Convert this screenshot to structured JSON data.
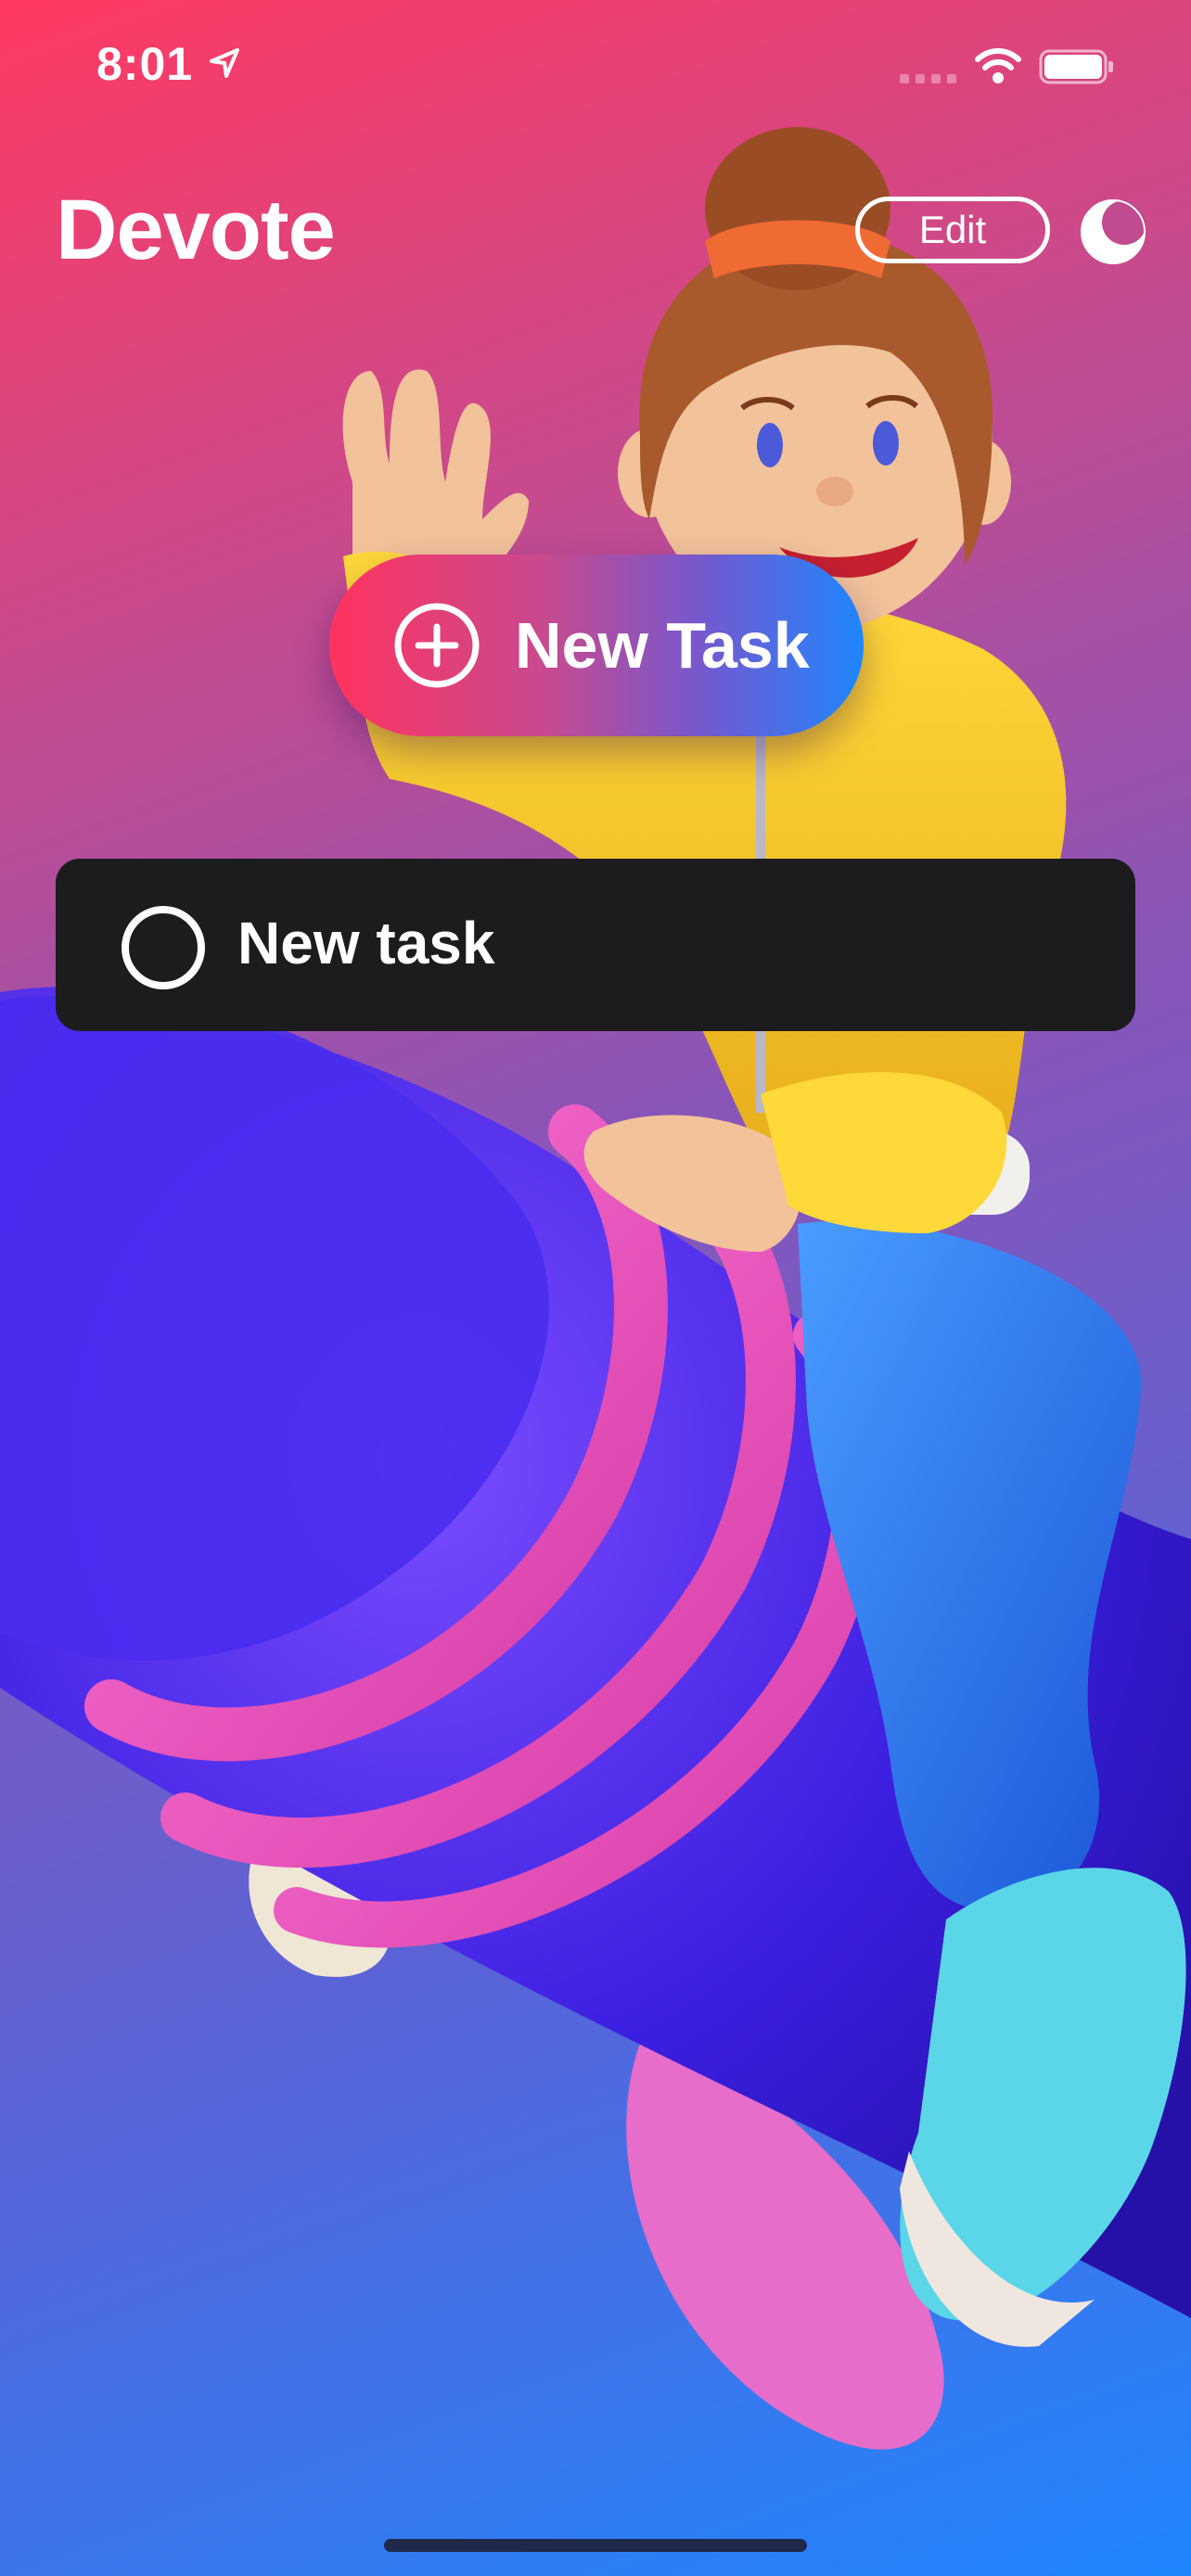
{
  "status_bar": {
    "time": "8:01",
    "icons": [
      "location-arrow-icon",
      "cellular-signal-icon",
      "wifi-icon",
      "battery-icon"
    ]
  },
  "header": {
    "title": "Devote",
    "edit_label": "Edit",
    "theme_toggle_icon": "moon-icon"
  },
  "new_task_button": {
    "label": "New Task",
    "icon": "plus-circle-icon"
  },
  "tasks": [
    {
      "title": "New task",
      "completed": false
    }
  ],
  "colors": {
    "gradient_top": "#ff3a62",
    "gradient_bottom": "#1f86ff",
    "card_background": "#1c1c1e",
    "text": "#ffffff"
  }
}
